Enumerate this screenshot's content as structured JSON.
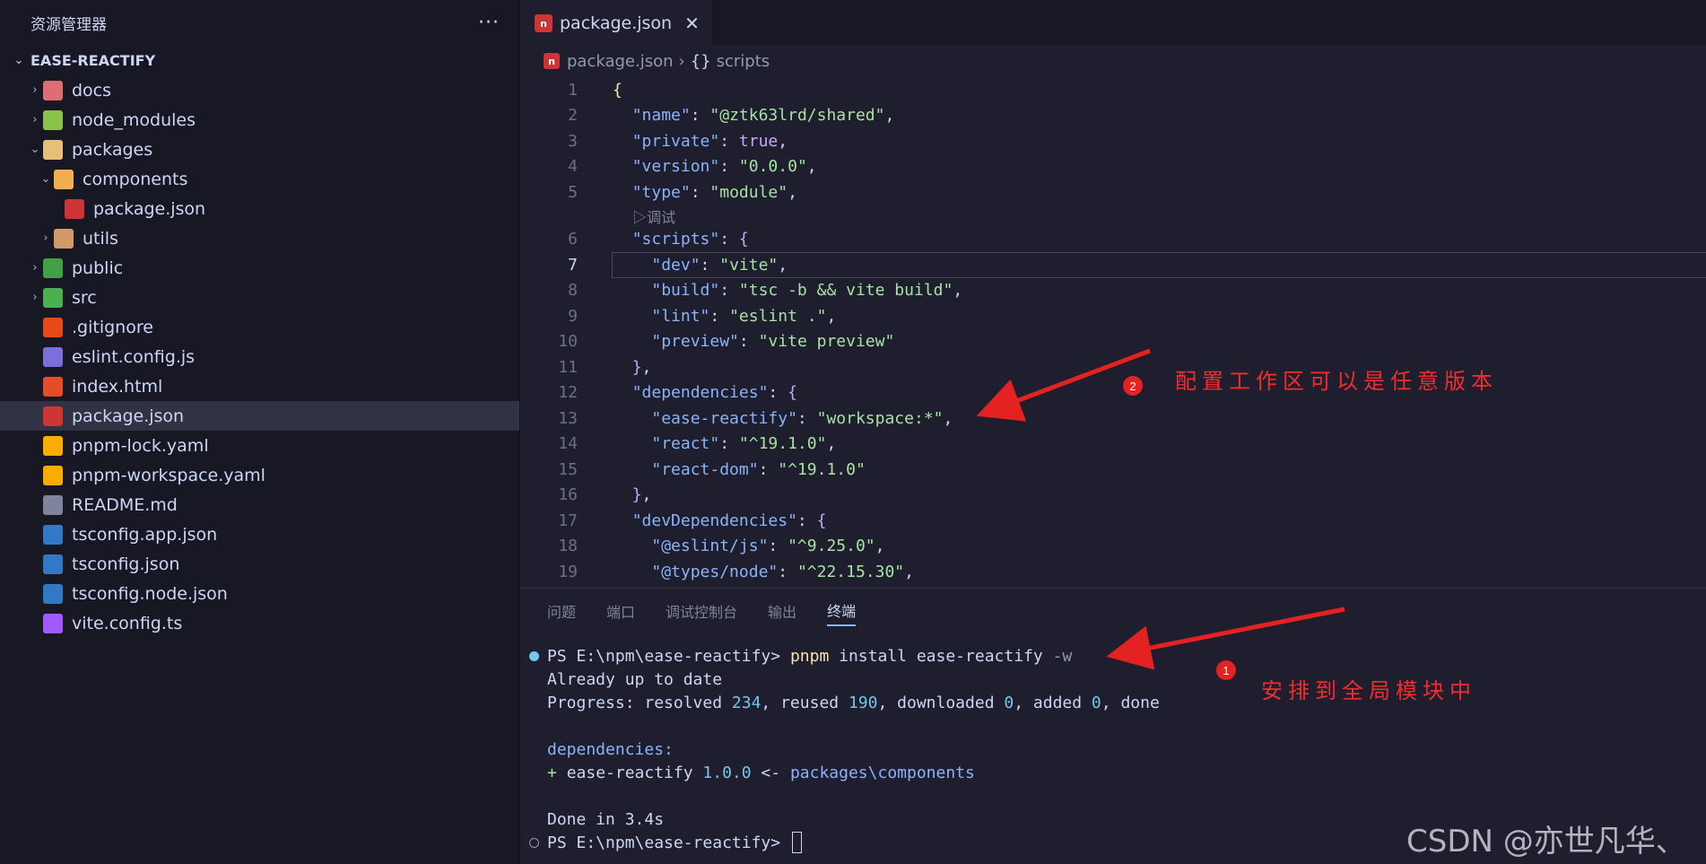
{
  "sidebar": {
    "title": "资源管理器",
    "more": "···",
    "root": "EASE-REACTIFY",
    "items": [
      {
        "label": "docs",
        "chev": "›",
        "indent": 0,
        "icon": "docs-folder-icon",
        "color": "#e06c75"
      },
      {
        "label": "node_modules",
        "chev": "›",
        "indent": 0,
        "icon": "node-folder-icon",
        "color": "#8bc34a"
      },
      {
        "label": "packages",
        "chev": "⌄",
        "indent": 0,
        "icon": "packages-folder-icon",
        "color": "#e5c07b"
      },
      {
        "label": "components",
        "chev": "⌄",
        "indent": 1,
        "icon": "components-folder-icon",
        "color": "#f0b050"
      },
      {
        "label": "package.json",
        "chev": "",
        "indent": 2,
        "icon": "npm-icon",
        "color": "#cc3534"
      },
      {
        "label": "utils",
        "chev": "›",
        "indent": 1,
        "icon": "utils-folder-icon",
        "color": "#d19a66"
      },
      {
        "label": "public",
        "chev": "›",
        "indent": 0,
        "icon": "public-folder-icon",
        "color": "#43a047"
      },
      {
        "label": "src",
        "chev": "›",
        "indent": 0,
        "icon": "src-folder-icon",
        "color": "#4caf50"
      },
      {
        "label": ".gitignore",
        "chev": "",
        "indent": 0,
        "icon": "git-icon",
        "color": "#e64a19"
      },
      {
        "label": "eslint.config.js",
        "chev": "",
        "indent": 0,
        "icon": "eslint-icon",
        "color": "#7c6fd9"
      },
      {
        "label": "index.html",
        "chev": "",
        "indent": 0,
        "icon": "html-icon",
        "color": "#e44d26"
      },
      {
        "label": "package.json",
        "chev": "",
        "indent": 0,
        "icon": "npm-icon",
        "color": "#cc3534",
        "selected": true
      },
      {
        "label": "pnpm-lock.yaml",
        "chev": "",
        "indent": 0,
        "icon": "pnpm-icon",
        "color": "#f9ad00"
      },
      {
        "label": "pnpm-workspace.yaml",
        "chev": "",
        "indent": 0,
        "icon": "pnpm-icon",
        "color": "#f9ad00"
      },
      {
        "label": "README.md",
        "chev": "",
        "indent": 0,
        "icon": "markdown-icon",
        "color": "#7f849c"
      },
      {
        "label": "tsconfig.app.json",
        "chev": "",
        "indent": 0,
        "icon": "tsconfig-icon",
        "color": "#3178c6"
      },
      {
        "label": "tsconfig.json",
        "chev": "",
        "indent": 0,
        "icon": "tsconfig-icon",
        "color": "#3178c6"
      },
      {
        "label": "tsconfig.node.json",
        "chev": "",
        "indent": 0,
        "icon": "tsconfig-icon",
        "color": "#3178c6"
      },
      {
        "label": "vite.config.ts",
        "chev": "",
        "indent": 0,
        "icon": "vite-icon",
        "color": "#a259ff"
      }
    ]
  },
  "editor": {
    "tab_label": "package.json",
    "tab_close": "✕",
    "breadcrumb": {
      "file": "package.json",
      "sep": "›",
      "braces": "{}",
      "section": "scripts"
    },
    "codelens": "▷调试",
    "lines": [
      {
        "n": "1",
        "tokens": [
          [
            "brace",
            "{"
          ]
        ]
      },
      {
        "n": "2",
        "tokens": [
          [
            "p",
            "  "
          ],
          [
            "k",
            "\"name\""
          ],
          [
            "p",
            ": "
          ],
          [
            "s",
            "\"@ztk63lrd/shared\""
          ],
          [
            "p",
            ","
          ]
        ]
      },
      {
        "n": "3",
        "tokens": [
          [
            "p",
            "  "
          ],
          [
            "k",
            "\"private\""
          ],
          [
            "p",
            ": "
          ],
          [
            "kw",
            "true"
          ],
          [
            "p",
            ","
          ]
        ]
      },
      {
        "n": "4",
        "tokens": [
          [
            "p",
            "  "
          ],
          [
            "k",
            "\"version\""
          ],
          [
            "p",
            ": "
          ],
          [
            "s",
            "\"0.0.0\""
          ],
          [
            "p",
            ","
          ]
        ]
      },
      {
        "n": "5",
        "tokens": [
          [
            "p",
            "  "
          ],
          [
            "k",
            "\"type\""
          ],
          [
            "p",
            ": "
          ],
          [
            "s",
            "\"module\""
          ],
          [
            "p",
            ","
          ]
        ]
      },
      {
        "n": "6",
        "tokens": [
          [
            "p",
            "  "
          ],
          [
            "k",
            "\"scripts\""
          ],
          [
            "p",
            ": "
          ],
          [
            "b",
            "{"
          ]
        ]
      },
      {
        "n": "7",
        "tokens": [
          [
            "p",
            "    "
          ],
          [
            "k",
            "\"dev\""
          ],
          [
            "p",
            ": "
          ],
          [
            "s",
            "\"vite\""
          ],
          [
            "p",
            ","
          ]
        ],
        "current": true
      },
      {
        "n": "8",
        "tokens": [
          [
            "p",
            "    "
          ],
          [
            "k",
            "\"build\""
          ],
          [
            "p",
            ": "
          ],
          [
            "s",
            "\"tsc -b && vite build\""
          ],
          [
            "p",
            ","
          ]
        ]
      },
      {
        "n": "9",
        "tokens": [
          [
            "p",
            "    "
          ],
          [
            "k",
            "\"lint\""
          ],
          [
            "p",
            ": "
          ],
          [
            "s",
            "\"eslint .\""
          ],
          [
            "p",
            ","
          ]
        ]
      },
      {
        "n": "10",
        "tokens": [
          [
            "p",
            "    "
          ],
          [
            "k",
            "\"preview\""
          ],
          [
            "p",
            ": "
          ],
          [
            "s",
            "\"vite preview\""
          ]
        ]
      },
      {
        "n": "11",
        "tokens": [
          [
            "p",
            "  "
          ],
          [
            "b",
            "}"
          ],
          [
            "p",
            ","
          ]
        ]
      },
      {
        "n": "12",
        "tokens": [
          [
            "p",
            "  "
          ],
          [
            "k",
            "\"dependencies\""
          ],
          [
            "p",
            ": "
          ],
          [
            "b",
            "{"
          ]
        ]
      },
      {
        "n": "13",
        "tokens": [
          [
            "p",
            "    "
          ],
          [
            "k",
            "\"ease-reactify\""
          ],
          [
            "p",
            ": "
          ],
          [
            "s",
            "\"workspace:*\""
          ],
          [
            "p",
            ","
          ]
        ]
      },
      {
        "n": "14",
        "tokens": [
          [
            "p",
            "    "
          ],
          [
            "k",
            "\"react\""
          ],
          [
            "p",
            ": "
          ],
          [
            "s",
            "\"^19.1.0\""
          ],
          [
            "p",
            ","
          ]
        ]
      },
      {
        "n": "15",
        "tokens": [
          [
            "p",
            "    "
          ],
          [
            "k",
            "\"react-dom\""
          ],
          [
            "p",
            ": "
          ],
          [
            "s",
            "\"^19.1.0\""
          ]
        ]
      },
      {
        "n": "16",
        "tokens": [
          [
            "p",
            "  "
          ],
          [
            "b",
            "}"
          ],
          [
            "p",
            ","
          ]
        ]
      },
      {
        "n": "17",
        "tokens": [
          [
            "p",
            "  "
          ],
          [
            "k",
            "\"devDependencies\""
          ],
          [
            "p",
            ": "
          ],
          [
            "b",
            "{"
          ]
        ]
      },
      {
        "n": "18",
        "tokens": [
          [
            "p",
            "    "
          ],
          [
            "k",
            "\"@eslint/js\""
          ],
          [
            "p",
            ": "
          ],
          [
            "s",
            "\"^9.25.0\""
          ],
          [
            "p",
            ","
          ]
        ]
      },
      {
        "n": "19",
        "tokens": [
          [
            "p",
            "    "
          ],
          [
            "k",
            "\"@types/node\""
          ],
          [
            "p",
            ": "
          ],
          [
            "s",
            "\"^22.15.30\""
          ],
          [
            "p",
            ","
          ]
        ]
      }
    ]
  },
  "panel": {
    "tabs": [
      {
        "label": "问题",
        "active": false
      },
      {
        "label": "端口",
        "active": false
      },
      {
        "label": "调试控制台",
        "active": false
      },
      {
        "label": "输出",
        "active": false
      },
      {
        "label": "终端",
        "active": true
      }
    ],
    "terminal": {
      "prompt1": "PS E:\\npm\\ease-reactify> ",
      "cmd": "pnpm",
      "cmd_args": " install ease-reactify ",
      "flag": "-w",
      "already": "Already up to date",
      "progress_prefix": "Progress: resolved ",
      "resolved": "234",
      "reused_label": ", reused ",
      "reused": "190",
      "downloaded_label": ", downloaded ",
      "downloaded": "0",
      "added_label": ", added ",
      "added": "0",
      "done_label": ", done",
      "deps_header": "dependencies:",
      "dep_plus": "+ ",
      "dep_name": "ease-reactify ",
      "dep_version": "1.0.0",
      "dep_arrow": " <- ",
      "dep_path": "packages\\components",
      "done_in": "Done in 3.4s",
      "prompt2": "PS E:\\npm\\ease-reactify> "
    }
  },
  "annotations": {
    "badge2": "2",
    "text2": "配置工作区可以是任意版本",
    "badge1": "1",
    "text1": "安排到全局模块中",
    "arrow_color": "#e52222"
  },
  "watermark": "CSDN @亦世凡华、"
}
